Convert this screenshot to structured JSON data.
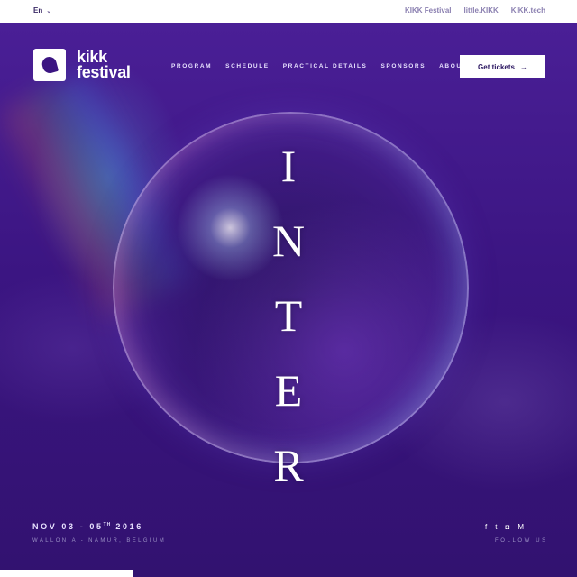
{
  "topbar": {
    "language": "En",
    "links": [
      "KIKK Festival",
      "little.KIKK",
      "KIKK.tech"
    ]
  },
  "brand": {
    "name_line1": "kikk",
    "name_line2": "festival"
  },
  "nav": {
    "items": [
      "PROGRAM",
      "SCHEDULE",
      "PRACTICAL DETAILS",
      "SPONSORS",
      "ABOUT"
    ],
    "cta_label": "Get tickets",
    "cta_arrow": "→"
  },
  "hero": {
    "letters": [
      "I",
      "N",
      "T",
      "E",
      "R"
    ]
  },
  "event": {
    "date_prefix": "NOV 03 - 05",
    "date_sup": "TH",
    "date_year": "2016",
    "location": "WALLONIA - NAMUR, BELGIUM"
  },
  "social": {
    "icons": [
      "facebook-icon",
      "twitter-icon",
      "instagram-icon",
      "medium-icon"
    ],
    "glyphs": [
      "f",
      "t",
      "◘",
      "M"
    ],
    "label": "FOLLOW US"
  },
  "colors": {
    "hero_bg": "#3b1582",
    "accent": "#ffffff"
  }
}
